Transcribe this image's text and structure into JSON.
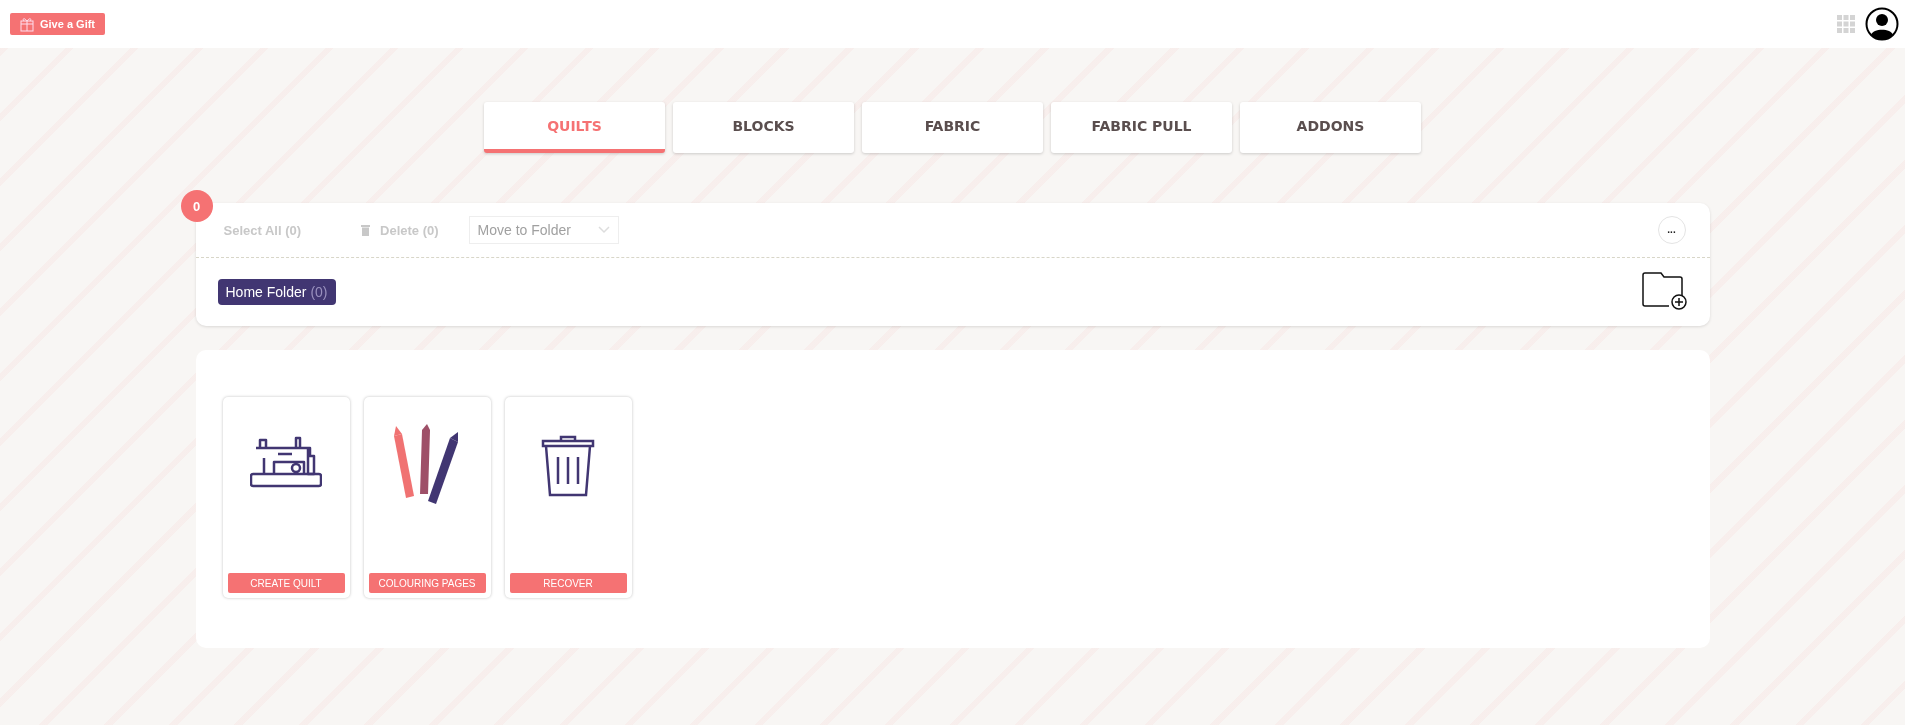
{
  "top_bar": {
    "gift_button": "Give a Gift"
  },
  "tabs": [
    {
      "label": "QUILTS",
      "selected": true
    },
    {
      "label": "BLOCKS",
      "selected": false
    },
    {
      "label": "FABRIC",
      "selected": false
    },
    {
      "label": "FABRIC PULL",
      "selected": false
    },
    {
      "label": "ADDONS",
      "selected": false
    }
  ],
  "toolbar": {
    "badge": "0",
    "select_all": "Select All (0)",
    "delete": "Delete (0)",
    "move_placeholder": "Move to Folder",
    "more": "..."
  },
  "folders": [
    {
      "name": "Home Folder",
      "count": "(0)",
      "selected": true
    }
  ],
  "cards": [
    {
      "kind": "sewing",
      "label": "CREATE QUILT"
    },
    {
      "kind": "pencils",
      "label": "COLOURING PAGES"
    },
    {
      "kind": "trash",
      "label": "RECOVER"
    }
  ]
}
